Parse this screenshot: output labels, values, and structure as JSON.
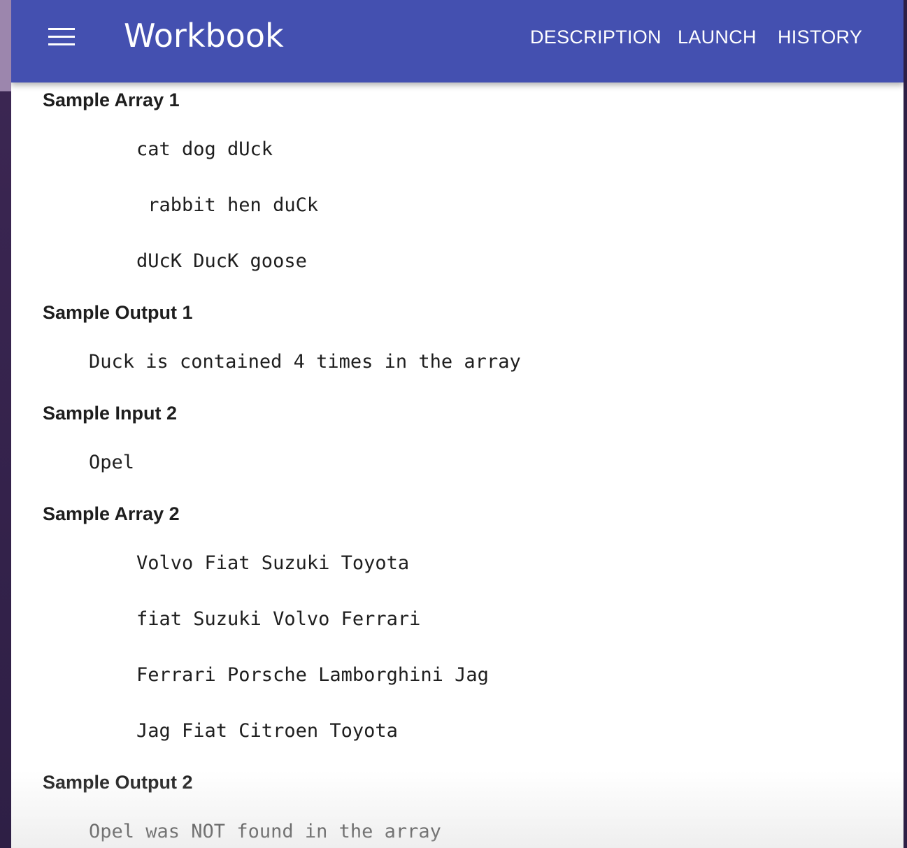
{
  "header": {
    "title": "Workbook",
    "nav": [
      "DESCRIPTION",
      "LAUNCH",
      "HISTORY"
    ],
    "menu_icon": "hamburger-icon",
    "color": "#4450b0"
  },
  "content": {
    "sample_array_1": {
      "heading": "Sample Array 1",
      "lines": [
        "cat dog dUck",
        " rabbit hen duCk",
        "dUcK DucK goose"
      ]
    },
    "sample_output_1": {
      "heading": "Sample Output 1",
      "text": "Duck is contained 4 times in the array"
    },
    "sample_input_2": {
      "heading": "Sample Input 2",
      "text": "Opel"
    },
    "sample_array_2": {
      "heading": "Sample Array 2",
      "lines": [
        "Volvo Fiat Suzuki Toyota",
        "fiat Suzuki Volvo Ferrari",
        "Ferrari Porsche Lamborghini Jag",
        "Jag Fiat Citroen Toyota"
      ]
    },
    "sample_output_2": {
      "heading": "Sample Output 2",
      "text": "Opel was NOT found in the array"
    }
  }
}
